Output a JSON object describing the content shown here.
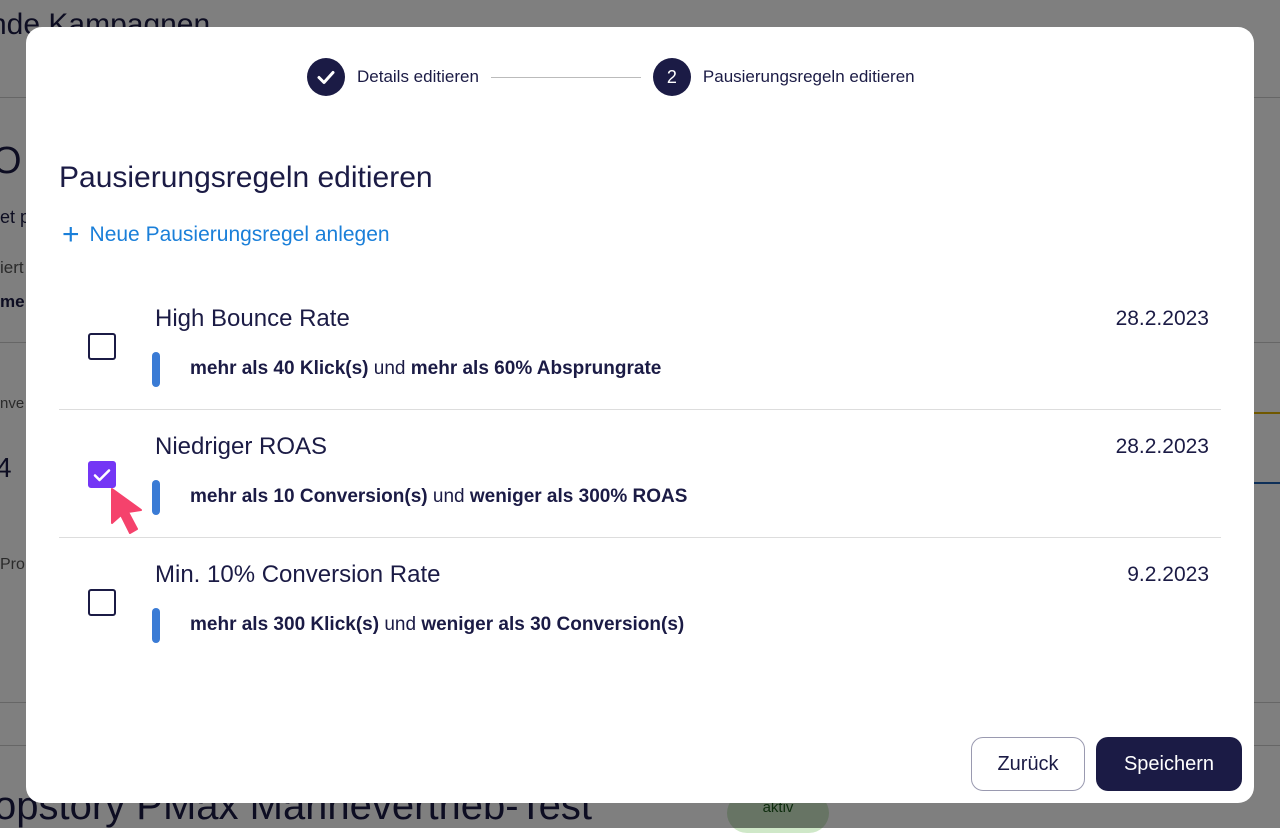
{
  "background": {
    "heading_fragment": "nde Kampagnen",
    "title_fragment": "O",
    "line1": "et p",
    "line2": "iert",
    "line3": "me",
    "line4": "nve",
    "value": "4",
    "line5": "Pro",
    "campaign_name": "opstory PMax Marinevertrieb-Test",
    "status_badge": "aktiv"
  },
  "stepper": {
    "steps": [
      {
        "label": "Details editieren",
        "state": "done",
        "icon": "check-icon"
      },
      {
        "number": "2",
        "label": "Pausierungsregeln editieren",
        "state": "active"
      }
    ]
  },
  "title": "Pausierungsregeln editieren",
  "add_rule_label": "Neue Pausierungsregel anlegen",
  "rules": [
    {
      "name": "High Bounce Rate",
      "date": "28.2.2023",
      "checked": false,
      "c1": "mehr als 40 Klick(s)",
      "joiner": "und",
      "c2": "mehr als 60% Absprungrate"
    },
    {
      "name": "Niedriger ROAS",
      "date": "28.2.2023",
      "checked": true,
      "c1": "mehr als 10 Conversion(s)",
      "joiner": "und",
      "c2": "weniger als 300% ROAS"
    },
    {
      "name": "Min. 10% Conversion Rate",
      "date": "9.2.2023",
      "checked": false,
      "c1": "mehr als 300 Klick(s)",
      "joiner": "und",
      "c2": "weniger als 30 Conversion(s)"
    }
  ],
  "buttons": {
    "back": "Zurück",
    "save": "Speichern"
  },
  "colors": {
    "primary": "#1b1b45",
    "accent": "#7436f5",
    "link": "#1a7fd9",
    "bar": "#3a7bd5",
    "cursor": "#f5426c"
  }
}
